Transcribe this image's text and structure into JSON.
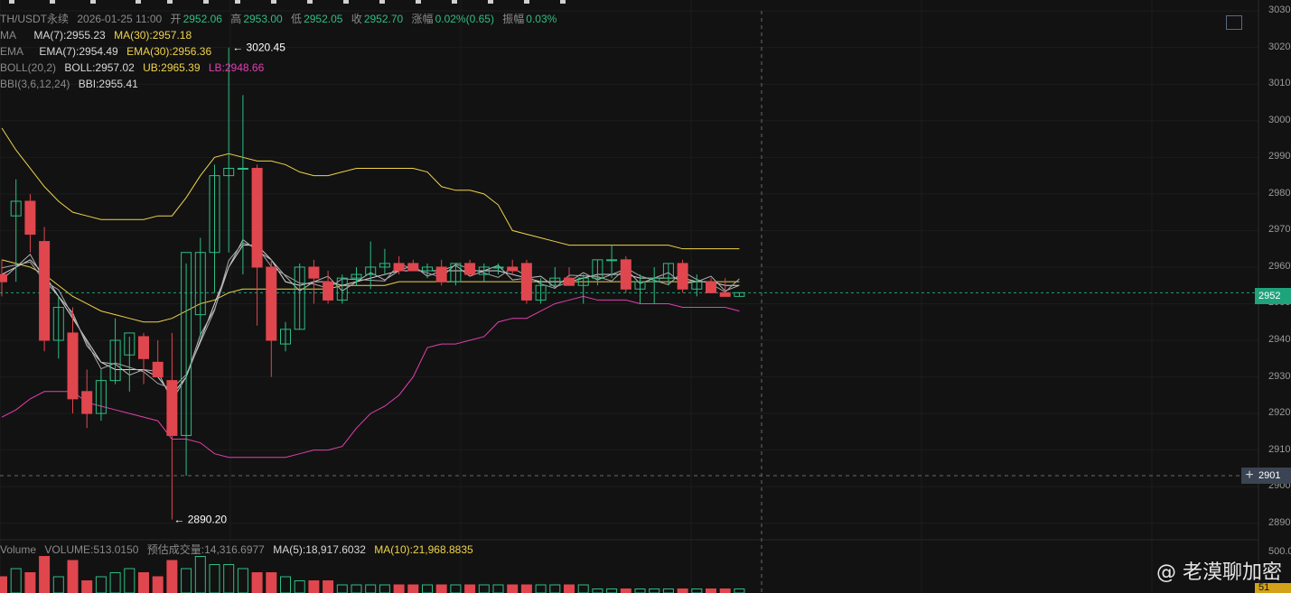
{
  "header": {
    "symbol": "TH/USDT永续",
    "datetime": "2026-01-25 11:00",
    "open_label": "开",
    "open": "2952.06",
    "high_label": "高",
    "high": "2953.00",
    "low_label": "低",
    "low": "2952.05",
    "close_label": "收",
    "close": "2952.70",
    "change_label": "涨幅",
    "change": "0.02%(0.65)",
    "amplitude_label": "振幅",
    "amplitude": "0.03%"
  },
  "indicators": {
    "ma": {
      "name": "MA",
      "ma7": "MA(7):2955.23",
      "ma30": "MA(30):2957.18"
    },
    "ema": {
      "name": "EMA",
      "ema7": "EMA(7):2954.49",
      "ema30": "EMA(30):2956.36"
    },
    "boll": {
      "name": "BOLL(20,2)",
      "boll": "BOLL:2957.02",
      "ub": "UB:2965.39",
      "lb": "LB:2948.66"
    },
    "bbi": {
      "name": "BBI(3,6,12,24)",
      "bbi": "BBI:2955.41"
    }
  },
  "volume_legend": {
    "name": "Volume",
    "volume": "VOLUME:513.0150",
    "estimated": "预估成交量:14,316.6977",
    "ma5": "MA(5):18,917.6032",
    "ma10": "MA(10):21,968.8835"
  },
  "annotations": {
    "high_marker": "3020.45",
    "low_marker": "2890.20"
  },
  "price_axis": {
    "labels": [
      "3030",
      "3020",
      "3010",
      "3000",
      "2990",
      "2980",
      "2970",
      "2960",
      "2950",
      "2940",
      "2930",
      "2920",
      "2910",
      "2900",
      "2890"
    ],
    "current_price_tag": "2952",
    "crosshair_price_tag": "2901",
    "volume_axis_label": "500.0",
    "volume_tag": "51"
  },
  "watermark": "@ 老漠聊加密",
  "colors": {
    "background": "#121212",
    "up": "#2ebd85",
    "down": "#e0464e",
    "ma_yellow": "#f0d34a",
    "boll_pink": "#e040b0",
    "line_white": "#d8d8d8"
  },
  "chart_data": {
    "type": "candlestick",
    "ylim": [
      2885,
      3033
    ],
    "candles": [
      {
        "o": 2958,
        "h": 2962,
        "l": 2952,
        "c": 2956
      },
      {
        "o": 2974,
        "h": 2984,
        "l": 2956,
        "c": 2978
      },
      {
        "o": 2978,
        "h": 2980,
        "l": 2964,
        "c": 2969
      },
      {
        "o": 2967,
        "h": 2971,
        "l": 2937,
        "c": 2940
      },
      {
        "o": 2940,
        "h": 2952,
        "l": 2935,
        "c": 2949
      },
      {
        "o": 2942,
        "h": 2949,
        "l": 2920,
        "c": 2924
      },
      {
        "o": 2926,
        "h": 2932,
        "l": 2916,
        "c": 2920
      },
      {
        "o": 2920,
        "h": 2932,
        "l": 2918,
        "c": 2929
      },
      {
        "o": 2929,
        "h": 2946,
        "l": 2928,
        "c": 2940
      },
      {
        "o": 2936,
        "h": 2941,
        "l": 2926,
        "c": 2942
      },
      {
        "o": 2941,
        "h": 2942,
        "l": 2928,
        "c": 2935
      },
      {
        "o": 2934,
        "h": 2940,
        "l": 2930,
        "c": 2930
      },
      {
        "o": 2929,
        "h": 2942,
        "l": 2891,
        "c": 2914
      },
      {
        "o": 2914,
        "h": 2961,
        "l": 2903,
        "c": 2964
      },
      {
        "o": 2947,
        "h": 2968,
        "l": 2941,
        "c": 2964
      },
      {
        "o": 2964,
        "h": 2988,
        "l": 2953,
        "c": 2985
      },
      {
        "o": 2985,
        "h": 3020,
        "l": 2964,
        "c": 2987
      },
      {
        "o": 2987,
        "h": 3007,
        "l": 2958,
        "c": 2987
      },
      {
        "o": 2987,
        "h": 2988,
        "l": 2944,
        "c": 2960
      },
      {
        "o": 2960,
        "h": 2962,
        "l": 2930,
        "c": 2940
      },
      {
        "o": 2939,
        "h": 2945,
        "l": 2937,
        "c": 2943
      },
      {
        "o": 2943,
        "h": 2961,
        "l": 2943,
        "c": 2960
      },
      {
        "o": 2960,
        "h": 2962,
        "l": 2950,
        "c": 2957
      },
      {
        "o": 2956,
        "h": 2959,
        "l": 2950,
        "c": 2951
      },
      {
        "o": 2951,
        "h": 2958,
        "l": 2950,
        "c": 2957
      },
      {
        "o": 2957,
        "h": 2960,
        "l": 2955,
        "c": 2958
      },
      {
        "o": 2958,
        "h": 2967,
        "l": 2954,
        "c": 2960
      },
      {
        "o": 2960,
        "h": 2965,
        "l": 2958,
        "c": 2961
      },
      {
        "o": 2961,
        "h": 2963,
        "l": 2958,
        "c": 2959
      },
      {
        "o": 2961,
        "h": 2962,
        "l": 2959,
        "c": 2959
      },
      {
        "o": 2959,
        "h": 2961,
        "l": 2957,
        "c": 2960
      },
      {
        "o": 2960,
        "h": 2962,
        "l": 2955,
        "c": 2956
      },
      {
        "o": 2956,
        "h": 2961,
        "l": 2955,
        "c": 2961
      },
      {
        "o": 2961,
        "h": 2962,
        "l": 2958,
        "c": 2958
      },
      {
        "o": 2958,
        "h": 2961,
        "l": 2956,
        "c": 2960
      },
      {
        "o": 2960,
        "h": 2961,
        "l": 2958,
        "c": 2960
      },
      {
        "o": 2960,
        "h": 2962,
        "l": 2958,
        "c": 2959
      },
      {
        "o": 2961,
        "h": 2962,
        "l": 2950,
        "c": 2951
      },
      {
        "o": 2951,
        "h": 2957,
        "l": 2950,
        "c": 2955
      },
      {
        "o": 2955,
        "h": 2960,
        "l": 2955,
        "c": 2957
      },
      {
        "o": 2957,
        "h": 2960,
        "l": 2955,
        "c": 2955
      },
      {
        "o": 2955,
        "h": 2958,
        "l": 2950,
        "c": 2957
      },
      {
        "o": 2957,
        "h": 2962,
        "l": 2955,
        "c": 2962
      },
      {
        "o": 2962,
        "h": 2966,
        "l": 2957,
        "c": 2962
      },
      {
        "o": 2962,
        "h": 2963,
        "l": 2953,
        "c": 2954
      },
      {
        "o": 2954,
        "h": 2958,
        "l": 2950,
        "c": 2956
      },
      {
        "o": 2956,
        "h": 2960,
        "l": 2950,
        "c": 2957
      },
      {
        "o": 2957,
        "h": 2961,
        "l": 2955,
        "c": 2961
      },
      {
        "o": 2961,
        "h": 2962,
        "l": 2953,
        "c": 2954
      },
      {
        "o": 2954,
        "h": 2958,
        "l": 2952,
        "c": 2956
      },
      {
        "o": 2956,
        "h": 2957,
        "l": 2953,
        "c": 2953
      },
      {
        "o": 2953,
        "h": 2957,
        "l": 2952,
        "c": 2952
      },
      {
        "o": 2952,
        "h": 2953,
        "l": 2952,
        "c": 2953
      }
    ],
    "ub_line": [
      2998,
      2992,
      2987,
      2982,
      2978,
      2975,
      2974,
      2973,
      2973,
      2973,
      2973,
      2974,
      2974,
      2979,
      2985,
      2990,
      2991,
      2990,
      2989,
      2989,
      2988,
      2986,
      2985,
      2985,
      2986,
      2987,
      2987,
      2987,
      2987,
      2987,
      2986,
      2982,
      2981,
      2981,
      2980,
      2977,
      2970,
      2969,
      2968,
      2967,
      2966,
      2966,
      2966,
      2966,
      2966,
      2966,
      2966,
      2966,
      2965,
      2965,
      2965,
      2965,
      2965
    ],
    "lb_line": [
      2919,
      2921,
      2924,
      2926,
      2926,
      2926,
      2923,
      2922,
      2921,
      2920,
      2919,
      2918,
      2913,
      2913,
      2912,
      2909,
      2908,
      2908,
      2908,
      2908,
      2908,
      2909,
      2910,
      2910,
      2911,
      2916,
      2920,
      2922,
      2925,
      2930,
      2938,
      2939,
      2939,
      2940,
      2941,
      2945,
      2946,
      2946,
      2948,
      2950,
      2951,
      2952,
      2951,
      2951,
      2951,
      2950,
      2950,
      2950,
      2949,
      2949,
      2949,
      2949,
      2948
    ],
    "yellow_line": [
      2962,
      2961,
      2960,
      2958,
      2955,
      2952,
      2950,
      2948,
      2947,
      2946,
      2945,
      2945,
      2946,
      2948,
      2950,
      2951,
      2953,
      2954,
      2954,
      2954,
      2954,
      2954,
      2954,
      2954,
      2955,
      2955,
      2955,
      2955,
      2956,
      2956,
      2956,
      2956,
      2956,
      2956,
      2956,
      2956,
      2956,
      2956,
      2956,
      2956,
      2956,
      2956,
      2956,
      2956,
      2956,
      2956,
      2956,
      2956,
      2956,
      2956,
      2956,
      2956,
      2956
    ],
    "white_line": [
      2958,
      2960,
      2962,
      2958,
      2952,
      2946,
      2940,
      2934,
      2932,
      2932,
      2932,
      2930,
      2925,
      2930,
      2940,
      2950,
      2960,
      2966,
      2966,
      2962,
      2956,
      2955,
      2956,
      2956,
      2955,
      2956,
      2957,
      2958,
      2959,
      2959,
      2959,
      2959,
      2959,
      2959,
      2959,
      2959,
      2958,
      2957,
      2956,
      2956,
      2956,
      2957,
      2958,
      2958,
      2958,
      2957,
      2957,
      2957,
      2957,
      2956,
      2956,
      2955,
      2955
    ],
    "volume": [
      4,
      6,
      5,
      9,
      4,
      8,
      3,
      4,
      5,
      6,
      5,
      4,
      8,
      6,
      9,
      7,
      7,
      6,
      5,
      5,
      4,
      3,
      3,
      3,
      2,
      2,
      2,
      2,
      2,
      2,
      2,
      2,
      2,
      2,
      2,
      2,
      2,
      2,
      2,
      2,
      2,
      2,
      1,
      1,
      1,
      1,
      1,
      1,
      1,
      1,
      1,
      1,
      1
    ]
  }
}
